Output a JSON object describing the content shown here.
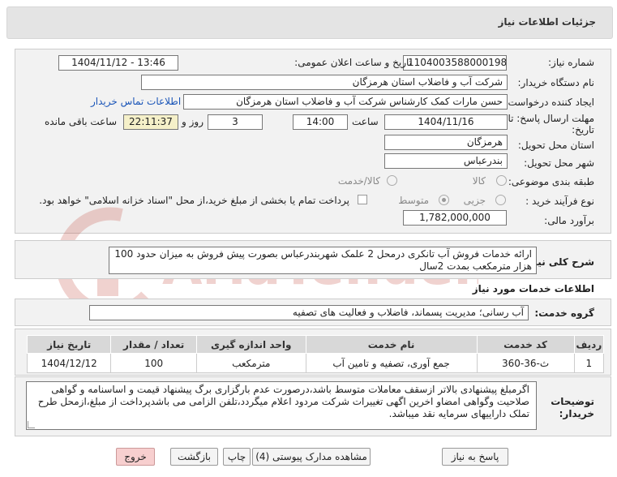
{
  "header": {
    "title": "جزئیات اطلاعات نیاز"
  },
  "form": {
    "need_number_label": "شماره نیاز:",
    "need_number": "1104003588000198",
    "announce_label": "تاریخ و ساعت اعلان عمومی:",
    "announce_value": "1404/11/12 - 13:46",
    "buyer_org_label": "نام دستگاه خریدار:",
    "buyer_org": "شرکت آب و فاضلاب استان هرمزگان",
    "creator_label": "ایجاد کننده درخواست:",
    "creator": "حسن مارات کمک کارشناس شرکت آب و فاضلاب استان هرمزگان",
    "contact_link": "اطلاعات تماس خریدار",
    "deadline_label_1": "مهلت ارسال پاسخ: تا",
    "deadline_label_2": "تاریخ:",
    "deadline_date": "1404/11/16",
    "time_label": "ساعت",
    "deadline_time": "14:00",
    "days_value": "3",
    "days_label": "روز و",
    "remaining_value": "22:11:37",
    "remaining_label": "ساعت باقی مانده",
    "province_label": "استان محل تحویل:",
    "province": "هرمزگان",
    "city_label": "شهر محل تحویل:",
    "city": "بندرعباس",
    "category_label": "طبقه بندی موضوعی:",
    "category_options": [
      "کالا",
      "کالا/خدمت"
    ],
    "process_label": "نوع فرآیند خرید :",
    "process_options": [
      "جزیی",
      "متوسط"
    ],
    "payment_note": "پرداخت تمام یا بخشی از مبلغ خرید،از محل \"اسناد خزانه اسلامی\" خواهد بود.",
    "estimate_label": "برآورد مالی:",
    "estimate": "1,782,000,000"
  },
  "description": {
    "label": "شرح کلی نیاز:",
    "text": "ارائه خدمات فروش آب تانکری درمحل 2 علمک شهربندرعباس بصورت پیش فروش به میزان حدود 100 هزار مترمکعب بمدت 2سال"
  },
  "services": {
    "section_title": "اطلاعات خدمات مورد نیاز",
    "group_label": "گروه خدمت:",
    "group_value": "آب رسانی؛ مدیریت پسماند، فاضلاب و فعالیت های تصفیه"
  },
  "table": {
    "headers": [
      "ردیف",
      "کد خدمت",
      "نام خدمت",
      "واحد اندازه گیری",
      "تعداد / مقدار",
      "تاریخ نیاز"
    ],
    "rows": [
      [
        "1",
        "ث-36-360",
        "جمع آوری، تصفیه و تامین آب",
        "مترمکعب",
        "100",
        "1404/12/12"
      ]
    ]
  },
  "notes": {
    "label_1": "توضیحات",
    "label_2": "خریدار:",
    "text": "اگرمبلغ پیشنهادی بالاتر ازسقف معاملات متوسط باشد،درصورت عدم بارگزاری برگ پیشنهاد قیمت و اساسنامه و گواهی صلاحیت وگواهی امضاو اخرین اگهی تغییرات شرکت مردود اعلام میگردد،تلفن الزامی می باشدپرداخت از مبلغ،ازمحل طرح تملک دارایيهای سرمایه نقد میباشد."
  },
  "buttons": {
    "reply": "پاسخ به نیاز",
    "attachments": "مشاهده مدارک پیوستی (4)",
    "print": "چاپ",
    "back": "بازگشت",
    "exit": "خروج"
  },
  "watermark": {
    "text": "AriaTender.net"
  },
  "colors": {
    "link": "#1a55b8",
    "remaining_bg": "#f5f0c9",
    "exit_bg": "#f7cfcf"
  }
}
